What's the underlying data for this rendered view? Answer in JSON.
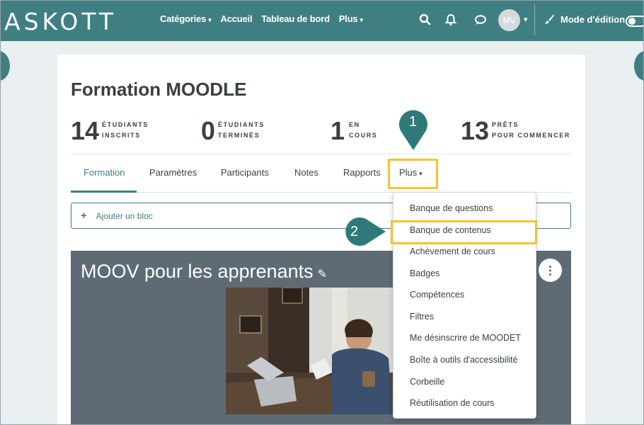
{
  "navbar": {
    "brand": "ASKOTT",
    "links": [
      "Catégories",
      "Accueil",
      "Tableau de bord",
      "Plus"
    ],
    "avatar_initials": "MV",
    "edit_mode_label": "Mode d'édition",
    "color": "#3f7f82"
  },
  "course": {
    "title": "Formation MOODLE",
    "stats": [
      {
        "value": "14",
        "line1": "ÉTUDIANTS",
        "line2": "INSCRITS"
      },
      {
        "value": "0",
        "line1": "ÉTUDIANTS",
        "line2": "TERMINÉS"
      },
      {
        "value": "1",
        "line1": "EN",
        "line2": "COURS"
      },
      {
        "value": "13",
        "line1": "PRÊTS",
        "line2": "POUR COMMENCER"
      }
    ]
  },
  "tabs": [
    "Formation",
    "Paramètres",
    "Participants",
    "Notes",
    "Rapports",
    "Plus"
  ],
  "add_block_label": "Ajouter un bloc",
  "section_title": "MOOV pour les apprenants",
  "dropdown": {
    "items": [
      "Banque de questions",
      "Banque de contenus",
      "Achèvement de cours",
      "Badges",
      "Compétences",
      "Filtres",
      "Me désinscrire de MOODET",
      "Boîte à outils d'accessibilité",
      "Corbeille",
      "Réutilisation de cours"
    ]
  },
  "markers": {
    "first": "1",
    "second": "2"
  }
}
